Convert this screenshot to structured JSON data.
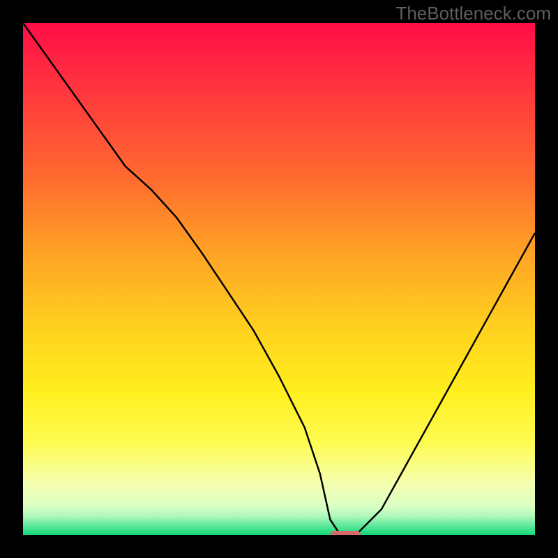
{
  "watermark": "TheBottleneck.com",
  "chart_data": {
    "type": "line",
    "title": "",
    "xlabel": "",
    "ylabel": "",
    "xlim": [
      0,
      100
    ],
    "ylim": [
      0,
      100
    ],
    "background_gradient": {
      "stops": [
        {
          "offset": 0.0,
          "color": "#ff0d47"
        },
        {
          "offset": 0.15,
          "color": "#ff3c3c"
        },
        {
          "offset": 0.3,
          "color": "#ff6a2f"
        },
        {
          "offset": 0.45,
          "color": "#ffa325"
        },
        {
          "offset": 0.6,
          "color": "#ffd21e"
        },
        {
          "offset": 0.72,
          "color": "#ffef1e"
        },
        {
          "offset": 0.82,
          "color": "#fffc52"
        },
        {
          "offset": 0.9,
          "color": "#f5ffb0"
        },
        {
          "offset": 0.945,
          "color": "#d9ffc4"
        },
        {
          "offset": 0.965,
          "color": "#a8f7b8"
        },
        {
          "offset": 0.982,
          "color": "#5ce89a"
        },
        {
          "offset": 1.0,
          "color": "#11d877"
        }
      ]
    },
    "series": [
      {
        "name": "bottleneck-curve",
        "color": "#000000",
        "x": [
          0,
          5,
          10,
          15,
          20,
          25,
          30,
          35,
          40,
          45,
          50,
          55,
          58,
          60,
          62,
          65,
          70,
          75,
          80,
          85,
          90,
          95,
          100
        ],
        "y": [
          100,
          93,
          86,
          79,
          72,
          67.5,
          62,
          55,
          47.5,
          40,
          31,
          21,
          12,
          3,
          0,
          0,
          5,
          14,
          23,
          32,
          41,
          50,
          59
        ]
      }
    ],
    "marker": {
      "name": "sweet-spot-marker",
      "color": "#d46a6a",
      "x_range": [
        60,
        66
      ],
      "y": 0
    }
  }
}
